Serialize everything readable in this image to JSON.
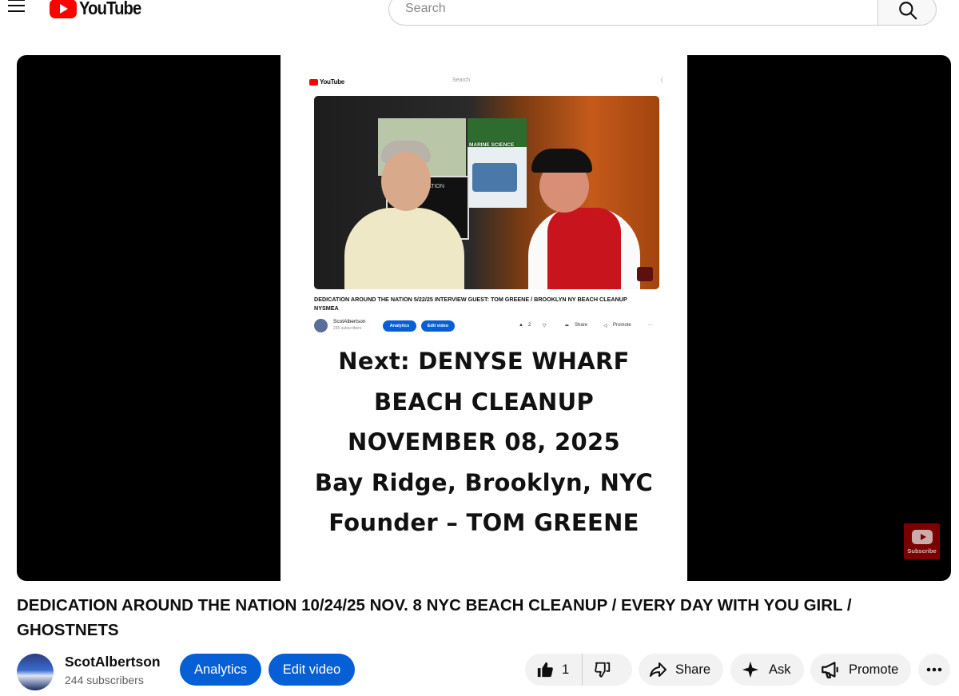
{
  "masthead": {
    "logo_text": "YouTube",
    "search_placeholder": "Search"
  },
  "player": {
    "embedded": {
      "logo_text": "YouTube",
      "search_placeholder": "Search",
      "poster_label": "MARINE SCIENCE",
      "poster_label2": "ATION",
      "video_title": "DEDICATION AROUND THE NATION 5/22/25 INTERVIEW GUEST: TOM GREENE / BROOKLYN NY BEACH CLEANUP NYSMEA",
      "channel_name": "ScotAlbertson",
      "subscribers": "235 subscribers",
      "analytics_label": "Analytics",
      "edit_label": "Edit video",
      "likes": "2",
      "share_label": "Share",
      "promote_label": "Promote",
      "more": "···"
    },
    "announcement_lines": [
      "Next: DENYSE WHARF",
      "BEACH CLEANUP",
      "NOVEMBER 08, 2025",
      "Bay Ridge, Brooklyn, NYC",
      "Founder – TOM GREENE"
    ],
    "subscribe_watermark": "Subscribe"
  },
  "video": {
    "title": "DEDICATION AROUND THE NATION 10/24/25 NOV. 8 NYC BEACH CLEANUP / EVERY DAY WITH YOU GIRL / GHOSTNETS",
    "channel_name": "ScotAlbertson",
    "subscribers": "244 subscribers",
    "analytics_label": "Analytics",
    "edit_label": "Edit video",
    "likes": "1",
    "share_label": "Share",
    "ask_label": "Ask",
    "promote_label": "Promote"
  },
  "colors": {
    "brand_red": "#ff0000",
    "action_blue": "#065fd4",
    "pill_grey": "#f2f2f2"
  }
}
